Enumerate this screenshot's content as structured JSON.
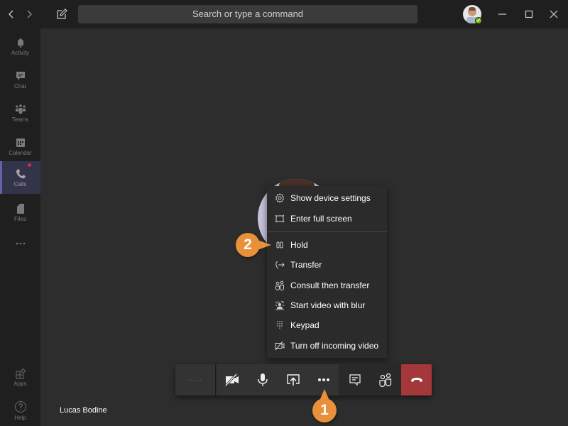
{
  "titlebar": {
    "back_icon": "chevron-left-icon",
    "forward_icon": "chevron-right-icon",
    "compose_icon": "compose-icon",
    "search_placeholder": "Search or type a command",
    "presence_status": "Available",
    "presence_color": "#6bb700",
    "window_controls": [
      "minimize",
      "maximize",
      "close"
    ]
  },
  "rail": {
    "items": [
      {
        "label": "Activity",
        "icon": "bell-icon"
      },
      {
        "label": "Chat",
        "icon": "chat-icon"
      },
      {
        "label": "Teams",
        "icon": "teams-icon"
      },
      {
        "label": "Calendar",
        "icon": "calendar-icon"
      },
      {
        "label": "Calls",
        "icon": "phone-icon",
        "active": true,
        "notification": true
      },
      {
        "label": "Files",
        "icon": "file-icon"
      },
      {
        "label": "...",
        "icon": "more-icon"
      }
    ],
    "bottom_items": [
      {
        "label": "Apps",
        "icon": "apps-icon"
      },
      {
        "label": "Help",
        "icon": "help-icon"
      }
    ],
    "accent_color": "#6264a7"
  },
  "stage": {
    "caller_name": "Lucas Bodine"
  },
  "more_menu": {
    "items": [
      {
        "label": "Show device settings",
        "icon": "gear-icon"
      },
      {
        "label": "Enter full screen",
        "icon": "fullscreen-icon"
      },
      {
        "label": "Hold",
        "icon": "hold-icon"
      },
      {
        "label": "Transfer",
        "icon": "transfer-icon"
      },
      {
        "label": "Consult then transfer",
        "icon": "consult-transfer-icon"
      },
      {
        "label": "Start video with blur",
        "icon": "video-blur-icon"
      },
      {
        "label": "Keypad",
        "icon": "keypad-icon"
      },
      {
        "label": "Turn off incoming video",
        "icon": "video-off-icon"
      }
    ]
  },
  "call_toolbar": {
    "timer": "--:--",
    "buttons": [
      {
        "name": "camera-off",
        "icon": "camera-off-icon"
      },
      {
        "name": "microphone",
        "icon": "microphone-icon"
      },
      {
        "name": "share-screen",
        "icon": "share-screen-icon"
      },
      {
        "name": "more-actions",
        "icon": "more-dots-icon"
      },
      {
        "name": "conversation",
        "icon": "chat-bubble-icon"
      },
      {
        "name": "participants",
        "icon": "people-icon"
      },
      {
        "name": "hang-up",
        "icon": "hang-up-icon"
      }
    ],
    "hangup_color": "#a4373a"
  },
  "callouts": [
    {
      "number": "1",
      "target": "more-actions",
      "color": "#e8913a"
    },
    {
      "number": "2",
      "target": "Hold",
      "color": "#e8913a"
    }
  ]
}
